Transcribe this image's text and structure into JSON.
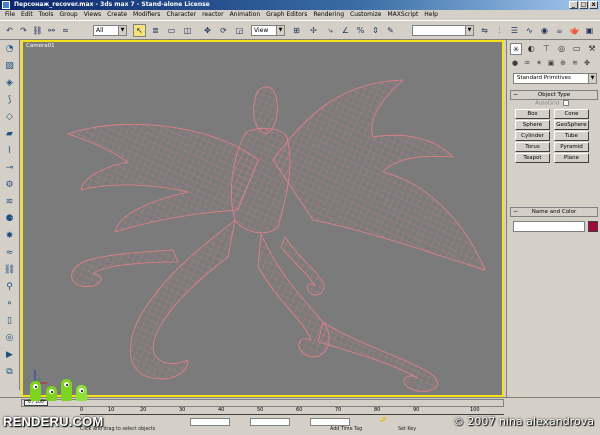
{
  "window": {
    "title": "Персонаж_recover.max - 3ds max 7 - Stand-alone License",
    "controls": [
      "_",
      "□",
      "x"
    ]
  },
  "menu": [
    "File",
    "Edit",
    "Tools",
    "Group",
    "Views",
    "Create",
    "Modifiers",
    "Character",
    "reactor",
    "Animation",
    "Graph Editors",
    "Rendering",
    "Customize",
    "MAXScript",
    "Help"
  ],
  "toolbar": {
    "selection_filter": "All",
    "reference_coord": "View",
    "named_selection": ""
  },
  "viewport": {
    "label": "Camera01",
    "border_color": "#f4e31a",
    "background": "#7b7b7b",
    "wire_color": "#e8808a"
  },
  "command_panel": {
    "dropdown": "Standard Primitives",
    "object_type": {
      "header": "Object Type",
      "autogrid": "AutoGrid",
      "buttons": [
        "Box",
        "Cone",
        "Sphere",
        "GeoSphere",
        "Cylinder",
        "Tube",
        "Torus",
        "Pyramid",
        "Teapot",
        "Plane"
      ]
    },
    "name_color": {
      "header": "Name and Color",
      "swatch": "#a0083c"
    }
  },
  "timeline": {
    "slider": "0 / 100",
    "ticks": [
      "0",
      "10",
      "20",
      "30",
      "40",
      "50",
      "60",
      "70",
      "80",
      "90",
      "100"
    ]
  },
  "status": {
    "prompt": "Click and drag to select objects",
    "add_time_tag": "Add Time Tag",
    "set_key": "Set Key"
  },
  "watermark": {
    "brand": "RENDERU.COM",
    "copyright": "© 2007 nina alexandrova"
  }
}
